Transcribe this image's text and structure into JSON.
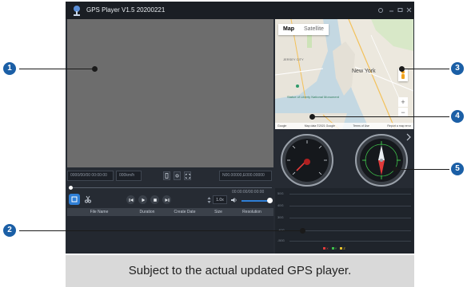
{
  "window": {
    "title": "GPS Player V1.5 20200221",
    "icons": [
      "app-logo-icon",
      "settings-icon",
      "minimize-icon",
      "maximize-icon",
      "close-icon"
    ]
  },
  "info_bar": {
    "datetime": "0000/00/00 00:00:00",
    "speed": "000km/h",
    "coordinates": "N00.00000,E000.00000"
  },
  "playback": {
    "time": "00:00:00/00:00:00",
    "speed_value": "1.0x",
    "progress": 0,
    "volume": 0.9
  },
  "file_table": {
    "columns": [
      "File Name",
      "Duration",
      "Create Date",
      "Size",
      "Resolution"
    ]
  },
  "map": {
    "tabs": [
      "Map",
      "Satellite"
    ],
    "active_tab": "Map",
    "labels": {
      "city": "New York",
      "statue": "Statue of Liberty National Monument",
      "state": "JERSEY CITY"
    },
    "zoom_in": "+",
    "zoom_out": "−",
    "footer": {
      "brand": "Google",
      "data": "Map data ©2021 Google",
      "terms": "Terms of Use",
      "report": "Report a map error"
    }
  },
  "graph": {
    "y_labels": [
      "50G",
      "40G",
      "30G",
      "-40G",
      "-50G"
    ],
    "legend": [
      {
        "label": "X",
        "color": "#e23a3a"
      },
      {
        "label": "Y",
        "color": "#3ec04a"
      },
      {
        "label": "Z",
        "color": "#e6c02a"
      }
    ]
  },
  "callouts": [
    "1",
    "2",
    "3",
    "4",
    "5"
  ],
  "caption": "Subject to the actual updated GPS player.",
  "colors": {
    "accent": "#2f7fd6",
    "callout": "#1b5fa6",
    "window_bg": "#262b33",
    "video_bg": "#6d6d6d"
  }
}
